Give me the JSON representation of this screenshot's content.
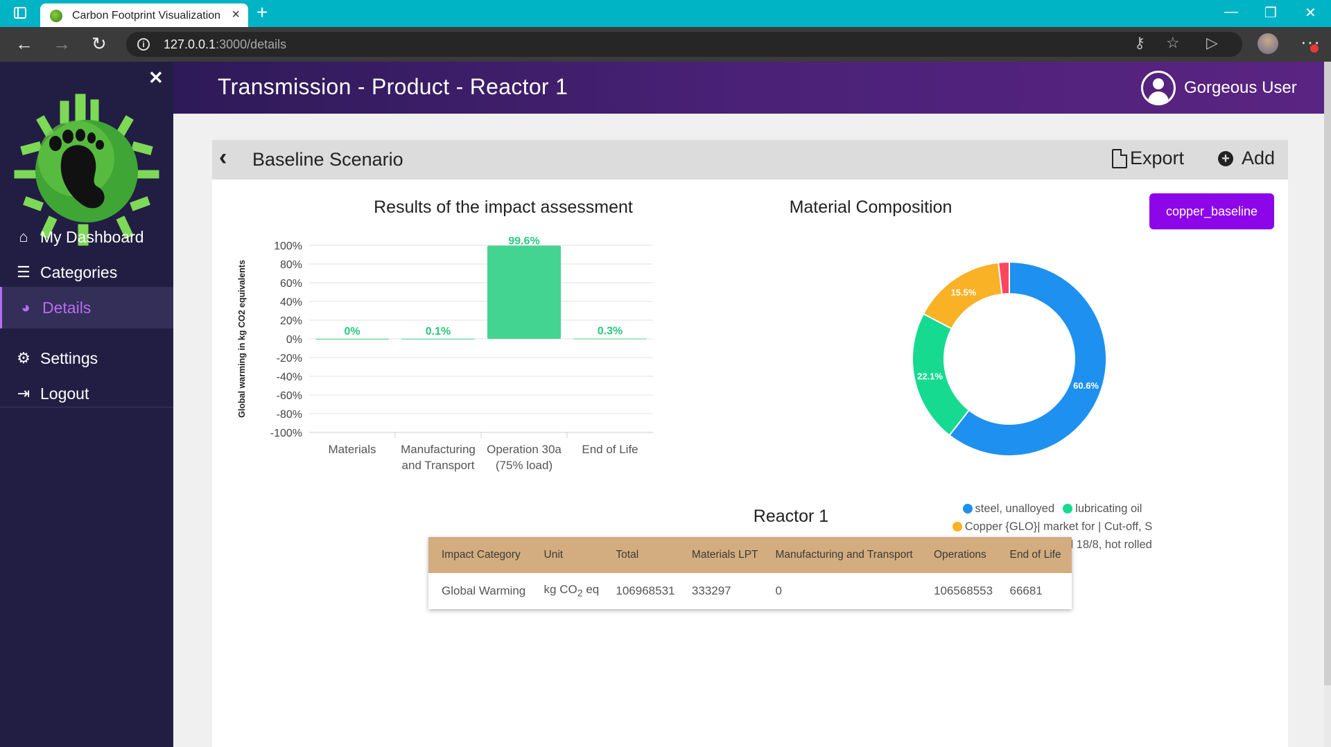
{
  "browser": {
    "tab_title": "Carbon Footprint Visualization",
    "url_host": "127.0.0.1",
    "url_path": ":3000/details"
  },
  "sidebar": {
    "items": [
      {
        "label": "My Dashboard",
        "icon": "home-icon"
      },
      {
        "label": "Categories",
        "icon": "list-icon"
      },
      {
        "label": "Details",
        "icon": "pie-chart-icon",
        "active": true
      },
      {
        "label": "Settings",
        "icon": "gears-icon"
      },
      {
        "label": "Logout",
        "icon": "sign-out-icon"
      }
    ]
  },
  "header": {
    "title": "Transmission - Product - Reactor 1",
    "user_name": "Gorgeous User"
  },
  "card": {
    "title": "Baseline Scenario",
    "export_label": "Export",
    "add_label": "Add",
    "scenario_pill": "copper_baseline"
  },
  "colors": {
    "accent": "#8d05e9",
    "sidebar_bg": "#221e43",
    "bar_green": "#44d492",
    "active_item": "#b86cf3",
    "table_header": "#d3ad7f"
  },
  "chart_data": [
    {
      "type": "bar",
      "title": "Results of the impact assessment",
      "ylabel": "Global warming in kg CO2 equivalents",
      "categories": [
        [
          "Materials"
        ],
        [
          "Manufacturing",
          "and Transport"
        ],
        [
          "Operation 30a",
          "(75% load)"
        ],
        [
          "End of Life"
        ]
      ],
      "values": [
        0,
        0.1,
        99.6,
        0.3
      ],
      "data_labels": [
        "0%",
        "0.1%",
        "99.6%",
        "0.3%"
      ],
      "ylim": [
        -100,
        100
      ],
      "yticks": [
        "100%",
        "80%",
        "60%",
        "40%",
        "20%",
        "0%",
        "-20%",
        "-40%",
        "-60%",
        "-80%",
        "-100%"
      ],
      "color": "#44d492",
      "grid": true
    },
    {
      "type": "pie",
      "variant": "donut",
      "title": "Material Composition",
      "slices": [
        {
          "label": "steel, unalloyed",
          "value": 60.6,
          "color": "#1e90f0",
          "data_label": "60.6%"
        },
        {
          "label": "lubricating oil",
          "value": 22.1,
          "color": "#16da90",
          "data_label": "22.1%"
        },
        {
          "label": "Copper {GLO}| market for | Cut-off, S",
          "value": 15.5,
          "color": "#f9b125",
          "data_label": "15.5%"
        },
        {
          "label": "steel, chromium steel 18/8, hot rolled",
          "value": 1.8,
          "color": "#ff4560",
          "data_label": ""
        }
      ],
      "legend": "bottom"
    }
  ],
  "table": {
    "title": "Reactor 1",
    "headers": [
      "Impact Category",
      "Unit",
      "Total",
      "Materials LPT",
      "Manufacturing and Transport",
      "Operations",
      "End of Life"
    ],
    "rows": [
      {
        "impact_category": "Global Warming",
        "unit_prefix": "kg CO",
        "unit_sub": "2",
        "unit_suffix": " eq",
        "total": "106968531",
        "materials": "333297",
        "manufacturing": "0",
        "operations": "106568553",
        "end_of_life": "66681"
      }
    ]
  }
}
